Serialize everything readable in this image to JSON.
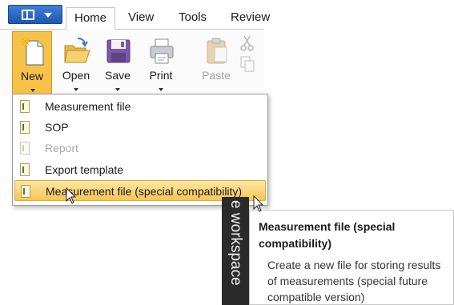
{
  "ribbon": {
    "tabs": [
      {
        "label": "Home",
        "active": true
      },
      {
        "label": "View",
        "active": false
      },
      {
        "label": "Tools",
        "active": false
      },
      {
        "label": "Review",
        "active": false
      }
    ],
    "buttons": [
      {
        "label": "New",
        "icon": "new-document-icon",
        "pressed": true,
        "has_dropdown": true,
        "disabled": false
      },
      {
        "label": "Open",
        "icon": "open-folder-icon",
        "pressed": false,
        "has_dropdown": true,
        "disabled": false
      },
      {
        "label": "Save",
        "icon": "floppy-disk-icon",
        "pressed": false,
        "has_dropdown": true,
        "disabled": false
      },
      {
        "label": "Print",
        "icon": "printer-icon",
        "pressed": false,
        "has_dropdown": true,
        "disabled": false
      },
      {
        "label": "Paste",
        "icon": "clipboard-paste-icon",
        "pressed": false,
        "has_dropdown": false,
        "disabled": true
      }
    ]
  },
  "new_menu": {
    "items": [
      {
        "label": "Measurement file",
        "icon": "measurement-file-icon",
        "disabled": false,
        "highlighted": false
      },
      {
        "label": "SOP",
        "icon": "sop-file-icon",
        "disabled": false,
        "highlighted": false
      },
      {
        "label": "Report",
        "icon": "report-file-icon",
        "disabled": true,
        "highlighted": false
      },
      {
        "label": "Export template",
        "icon": "export-template-icon",
        "disabled": false,
        "highlighted": false
      },
      {
        "label": "Measurement file (special compatibility)",
        "icon": "measurement-file-icon",
        "disabled": false,
        "highlighted": true
      }
    ]
  },
  "workspace_label": "e workspace",
  "tooltip": {
    "title": "Measurement file (special compatibility)",
    "description": "Create a new file for storing results of measurements (special future compatible version)"
  },
  "colors": {
    "accent": "#f6c24a",
    "app_button": "#2a66c3",
    "highlight_border": "#e2a838",
    "workspace_bg": "#2b2b2b"
  }
}
